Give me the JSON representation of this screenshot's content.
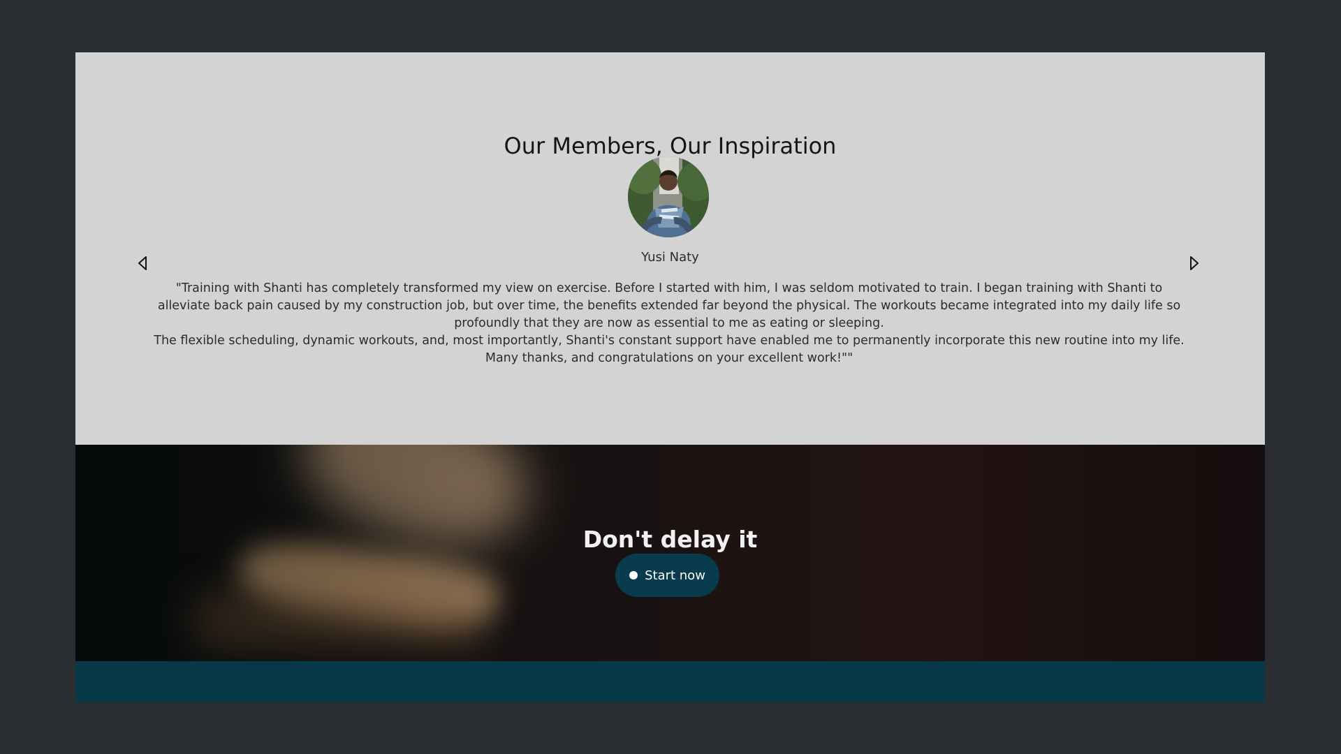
{
  "testimonials": {
    "title": "Our Members, Our Inspiration",
    "member_name": "Yusi Naty",
    "quote_line_1": "\"Training with Shanti has completely transformed my view on exercise. Before I started with him, I was seldom motivated to train. I began training with Shanti to alleviate back pain caused by my construction job, but over time, the benefits extended far beyond the physical. The workouts became integrated into my daily life so profoundly that they are now as essential to me as eating or sleeping.",
    "quote_line_2": "The flexible scheduling, dynamic workouts, and, most importantly, Shanti's constant support have enabled me to permanently incorporate this new routine into my life. Many thanks, and congratulations on your excellent work!\"\"",
    "prev_icon": "chevron-left-icon",
    "next_icon": "chevron-right-icon"
  },
  "cta": {
    "title": "Don't delay it",
    "button_label": "Start now"
  },
  "colors": {
    "page_background": "#2a2d32",
    "testimonial_background": "#d3d3d3",
    "button_background": "#083b4e",
    "footer_background": "#063848"
  }
}
